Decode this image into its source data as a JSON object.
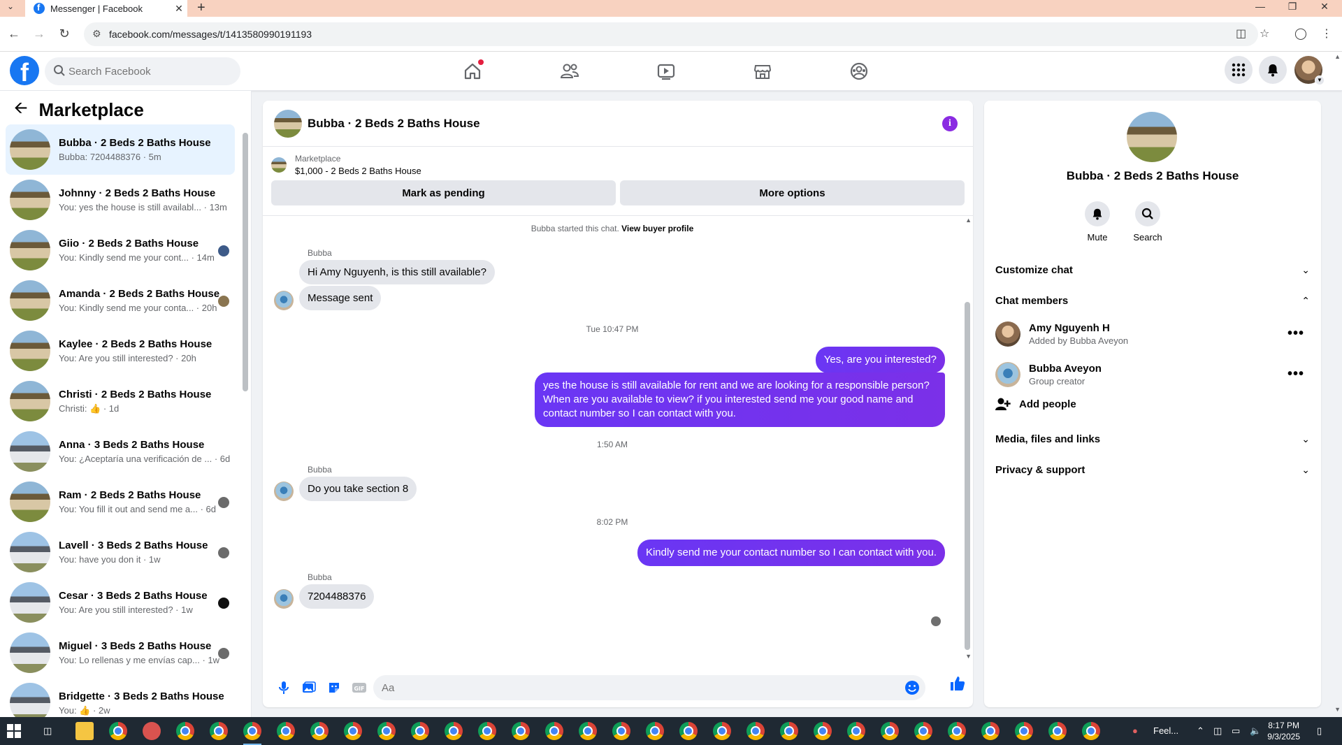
{
  "browser": {
    "tab_title": "Messenger | Facebook",
    "url": "facebook.com/messages/t/1413580990191193"
  },
  "header": {
    "search_placeholder": "Search Facebook"
  },
  "sidebar": {
    "title": "Marketplace",
    "conversations": [
      {
        "name": "Bubba · 2 Beds 2 Baths House",
        "snippet": "Bubba: 7204488376 · 5m",
        "active": true,
        "thumb": "house-a"
      },
      {
        "name": "Johnny · 2 Beds 2 Baths House",
        "snippet": "You: yes the house is still availabl... · 13m",
        "thumb": "house-a"
      },
      {
        "name": "Giio · 2 Beds 2 Baths House",
        "snippet": "You: Kindly send me your cont... · 14m",
        "thumb": "house-a"
      },
      {
        "name": "Amanda · 2 Beds 2 Baths House",
        "snippet": "You: Kindly send me your conta... · 20h",
        "thumb": "house-a"
      },
      {
        "name": "Kaylee · 2 Beds 2 Baths House",
        "snippet": "You: Are you still interested? · 20h",
        "thumb": "house-a"
      },
      {
        "name": "Christi · 2 Beds 2 Baths House",
        "snippet": "Christi: 👍 · 1d",
        "thumb": "house-a"
      },
      {
        "name": "Anna · 3 Beds 2 Baths House",
        "snippet": "You: ¿Aceptaría una verificación de ... · 6d",
        "thumb": "house-b"
      },
      {
        "name": "Ram · 2 Beds 2 Baths House",
        "snippet": "You: You fill it out and send me a... · 6d",
        "thumb": "house-a"
      },
      {
        "name": "Lavell · 3 Beds 2 Baths House",
        "snippet": "You: have you don it · 1w",
        "thumb": "house-b"
      },
      {
        "name": "Cesar · 3 Beds 2 Baths House",
        "snippet": "You: Are you still interested? · 1w",
        "thumb": "house-b"
      },
      {
        "name": "Miguel · 3 Beds 2 Baths House",
        "snippet": "You: Lo rellenas y me envías cap... · 1w",
        "thumb": "house-b"
      },
      {
        "name": "Bridgette · 3 Beds 2 Baths House",
        "snippet": "You: 👍 · 2w",
        "thumb": "house-b"
      }
    ]
  },
  "chat": {
    "title": "Bubba · 2 Beds 2 Baths House",
    "marketplace_label": "Marketplace",
    "listing": "$1,000 - 2 Beds 2 Baths House",
    "mark_pending": "Mark as pending",
    "more_options": "More options",
    "started_text": "Bubba started this chat.",
    "view_buyer_profile": "View buyer profile",
    "sender": "Bubba",
    "msg1": "Hi Amy Nguyenh, is this still available?",
    "msg2": "Message sent",
    "ts1": "Tue 10:47 PM",
    "out1": "Yes, are you interested?",
    "out2": "yes the house is still available for rent and we are looking for a responsible person? When are you available to view? if you interested send me your good name and contact number  so I can contact with you.",
    "ts2": "1:50 AM",
    "msg3": "Do you take section 8",
    "ts3": "8:02 PM",
    "out3": "Kindly send me your contact number so I can contact with you.",
    "msg4": "7204488376",
    "composer_placeholder": "Aa"
  },
  "rpanel": {
    "title": "Bubba · 2 Beds 2 Baths House",
    "mute": "Mute",
    "search": "Search",
    "customize_chat": "Customize chat",
    "chat_members": "Chat members",
    "members": [
      {
        "name": "Amy Nguyenh H",
        "sub": "Added by Bubba Aveyon"
      },
      {
        "name": "Bubba Aveyon",
        "sub": "Group creator"
      }
    ],
    "add_people": "Add people",
    "media_files_links": "Media, files and links",
    "privacy_support": "Privacy & support"
  },
  "taskbar": {
    "weather": "Feel...",
    "time": "8:17 PM",
    "date": "9/3/2025"
  }
}
